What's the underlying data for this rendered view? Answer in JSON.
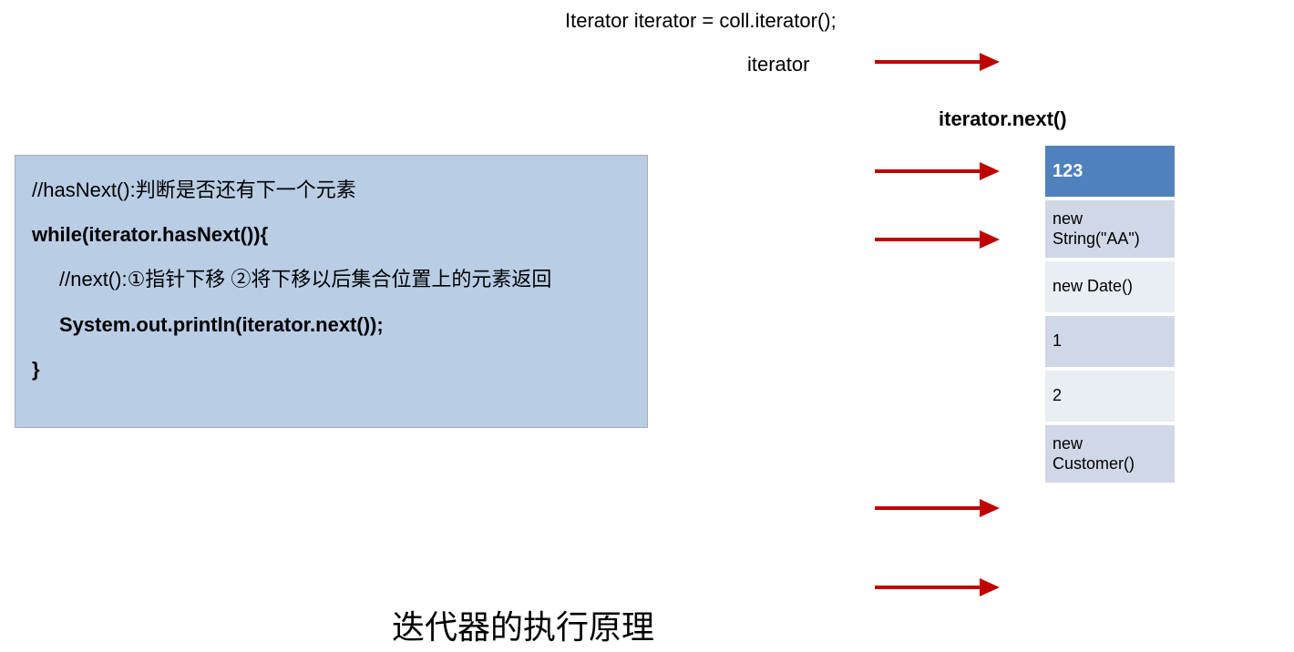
{
  "topCode": "Iterator iterator = coll.iterator();",
  "iteratorLabel": "iterator",
  "iteratorNext": "iterator.next()",
  "code": {
    "line1": "//hasNext():判断是否还有下一个元素",
    "line2": "while(iterator.hasNext()){",
    "line3": "//next():①指针下移 ②将下移以后集合位置上的元素返回",
    "line4": "System.out.println(iterator.next());",
    "line5": "}"
  },
  "cells": {
    "c0": "123",
    "c1": "new String(\"AA\")",
    "c2": "new Date()",
    "c3": "1",
    "c4": "2",
    "c5": "new Customer()"
  },
  "title": "迭代器的执行原理",
  "colors": {
    "arrow": "#c00000",
    "active": "#4f81bd",
    "codebox": "#b9cde5"
  }
}
